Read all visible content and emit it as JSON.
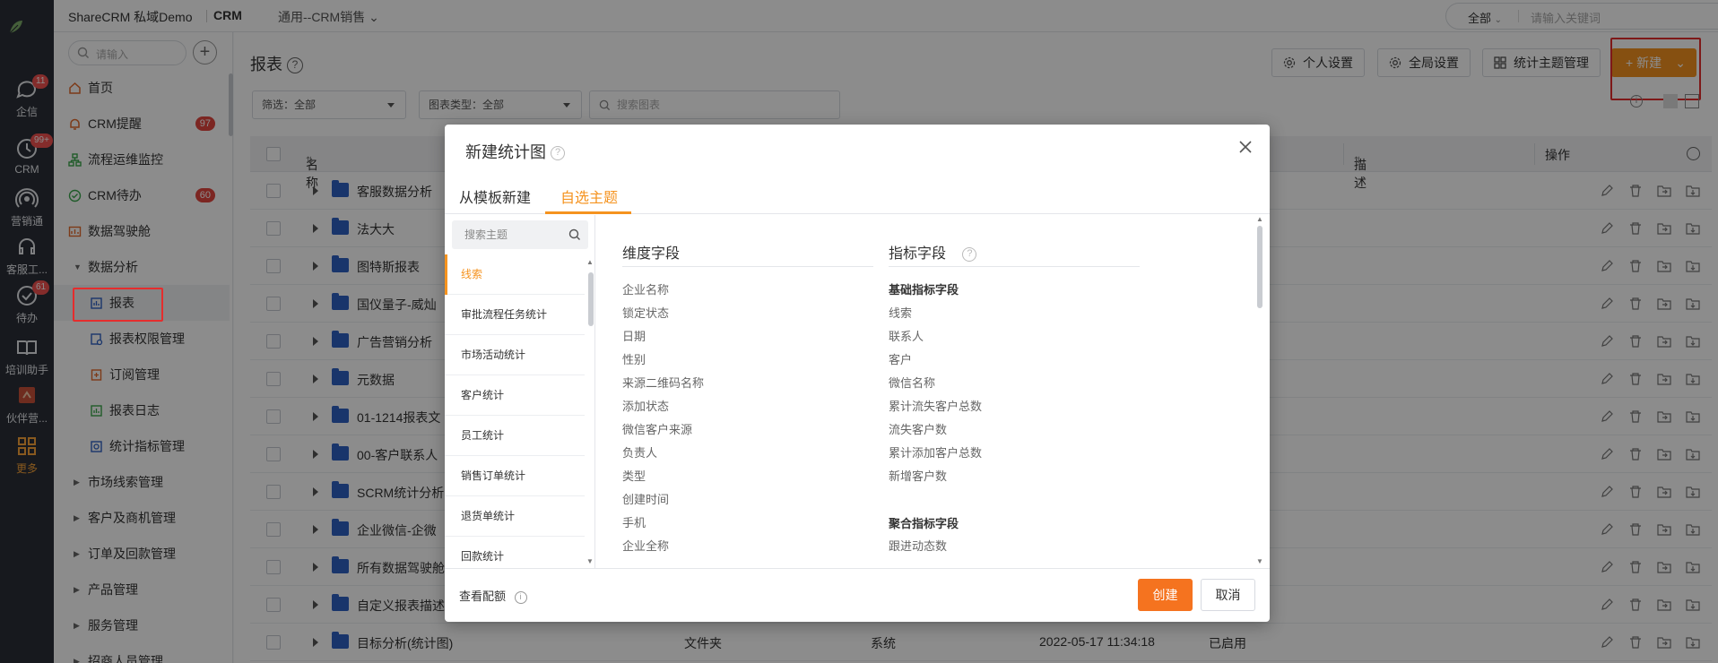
{
  "rail": {
    "items": [
      {
        "label": "企信",
        "badge": "11"
      },
      {
        "label": "CRM",
        "badge": "99+"
      },
      {
        "label": "营销通",
        "badge": ""
      },
      {
        "label": "客服工...",
        "badge": ""
      },
      {
        "label": "待办",
        "badge": "61"
      },
      {
        "label": "培训助手",
        "badge": ""
      },
      {
        "label": "伙伴营...",
        "badge": ""
      },
      {
        "label": "更多",
        "badge": ""
      }
    ]
  },
  "topbar": {
    "brand": "ShareCRM 私域Demo",
    "app": "CRM",
    "scope": "通用--CRM销售",
    "search_scope": "全部",
    "search_placeholder": "请输入关键词"
  },
  "nav": {
    "search_placeholder": "请输入",
    "items": [
      {
        "label": "首页",
        "count": ""
      },
      {
        "label": "CRM提醒",
        "count": "97"
      },
      {
        "label": "流程运维监控",
        "count": ""
      },
      {
        "label": "CRM待办",
        "count": "60"
      },
      {
        "label": "数据驾驶舱",
        "count": ""
      }
    ],
    "group_open": "数据分析",
    "subitems": [
      "报表",
      "报表权限管理",
      "订阅管理",
      "报表日志",
      "统计指标管理"
    ],
    "groups": [
      "市场线索管理",
      "客户及商机管理",
      "订单及回款管理",
      "产品管理",
      "服务管理",
      "招商人员管理"
    ]
  },
  "main": {
    "title": "报表",
    "buttons": {
      "personal": "个人设置",
      "global": "全局设置",
      "theme": "统计主题管理",
      "new": "新建"
    },
    "filters": {
      "filter": "筛选：全部",
      "chart_type": "图表类型：全部",
      "search_placeholder": "搜索图表"
    },
    "columns": {
      "name": "名称",
      "desc": "描述",
      "ops": "操作"
    },
    "rows": [
      {
        "name": "客服数据分析",
        "type": "",
        "creator": "",
        "time": "",
        "status": ""
      },
      {
        "name": "法大大",
        "type": "",
        "creator": "",
        "time": "",
        "status": ""
      },
      {
        "name": "图特斯报表",
        "type": "",
        "creator": "",
        "time": "",
        "status": ""
      },
      {
        "name": "国仪量子-威灿",
        "type": "",
        "creator": "",
        "time": "",
        "status": ""
      },
      {
        "name": "广告营销分析",
        "type": "",
        "creator": "",
        "time": "",
        "status": ""
      },
      {
        "name": "元数据",
        "type": "",
        "creator": "",
        "time": "",
        "status": ""
      },
      {
        "name": "01-1214报表文",
        "type": "",
        "creator": "",
        "time": "",
        "status": ""
      },
      {
        "name": "00-客户联系人",
        "type": "",
        "creator": "",
        "time": "",
        "status": ""
      },
      {
        "name": "SCRM统计分析",
        "type": "",
        "creator": "",
        "time": "",
        "status": ""
      },
      {
        "name": "企业微信-企微",
        "type": "",
        "creator": "",
        "time": "",
        "status": ""
      },
      {
        "name": "所有数据驾驶舱",
        "type": "",
        "creator": "",
        "time": "",
        "status": ""
      },
      {
        "name": "自定义报表描述",
        "type": "",
        "creator": "",
        "time": "",
        "status": ""
      },
      {
        "name": "目标分析(统计图)",
        "type": "文件夹",
        "creator": "系统",
        "time": "2022-05-17 11:34:18",
        "status": "已启用"
      }
    ]
  },
  "modal": {
    "title": "新建统计图",
    "tabs": [
      "从模板新建",
      "自选主题"
    ],
    "theme_search_placeholder": "搜索主题",
    "themes": [
      "线索",
      "审批流程任务统计",
      "市场活动统计",
      "客户统计",
      "员工统计",
      "销售订单统计",
      "退货单统计",
      "回款统计"
    ],
    "dimension_title": "维度字段",
    "dimension_fields": [
      "企业名称",
      "锁定状态",
      "日期",
      "性别",
      "来源二维码名称",
      "添加状态",
      "微信客户来源",
      "负责人",
      "类型",
      "创建时间",
      "手机",
      "企业全称"
    ],
    "metric_title": "指标字段",
    "metric_basic_title": "基础指标字段",
    "metric_basic_fields": [
      "线索",
      "联系人",
      "客户",
      "微信名称",
      "累计流失客户总数",
      "流失客户数",
      "累计添加客户总数",
      "新增客户数"
    ],
    "metric_agg_title": "聚合指标字段",
    "metric_agg_fields": [
      "跟进动态数"
    ],
    "quota_label": "查看配额",
    "create_label": "创建",
    "cancel_label": "取消"
  }
}
